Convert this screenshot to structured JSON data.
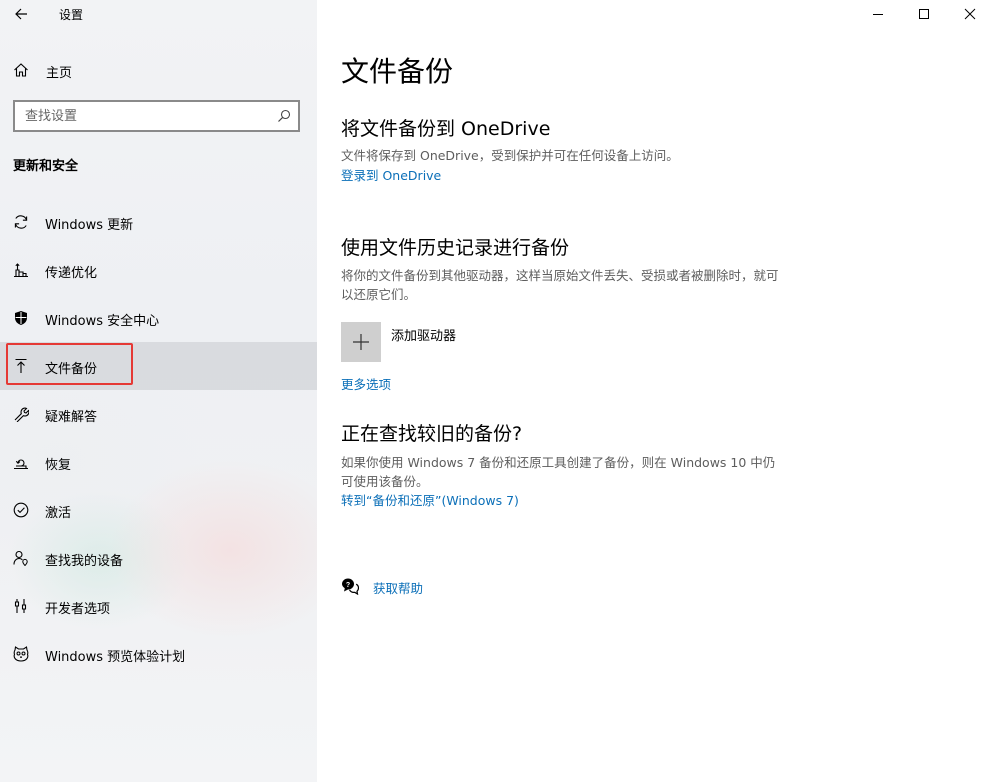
{
  "window": {
    "title": "设置",
    "controls": {
      "minimize": "minimize-icon",
      "maximize": "maximize-icon",
      "close": "close-icon"
    }
  },
  "sidebar": {
    "home_label": "主页",
    "search_placeholder": "查找设置",
    "section_title": "更新和安全",
    "items": [
      {
        "label": "Windows 更新",
        "icon": "refresh-icon"
      },
      {
        "label": "传递优化",
        "icon": "delivery-optimization-icon"
      },
      {
        "label": "Windows 安全中心",
        "icon": "shield-icon"
      },
      {
        "label": "文件备份",
        "icon": "backup-upload-icon",
        "active": true
      },
      {
        "label": "疑难解答",
        "icon": "wrench-icon"
      },
      {
        "label": "恢复",
        "icon": "recovery-icon"
      },
      {
        "label": "激活",
        "icon": "check-circle-icon"
      },
      {
        "label": "查找我的设备",
        "icon": "person-location-icon"
      },
      {
        "label": "开发者选项",
        "icon": "developer-tools-icon"
      },
      {
        "label": "Windows 预览体验计划",
        "icon": "insider-cat-icon"
      }
    ]
  },
  "main": {
    "title": "文件备份",
    "onedrive": {
      "heading": "将文件备份到 OneDrive",
      "desc": "文件将保存到 OneDrive，受到保护并可在任何设备上访问。",
      "link": "登录到 OneDrive"
    },
    "file_history": {
      "heading": "使用文件历史记录进行备份",
      "desc": "将你的文件备份到其他驱动器，这样当原始文件丢失、受损或者被删除时，就可以还原它们。",
      "add_drive": "添加驱动器",
      "more_options": "更多选项"
    },
    "older_backup": {
      "heading": "正在查找较旧的备份?",
      "desc": "如果你使用 Windows 7 备份和还原工具创建了备份，则在 Windows 10 中仍可使用该备份。",
      "link": "转到“备份和还原”(Windows 7)"
    },
    "help_label": "获取帮助"
  },
  "colors": {
    "accent": "#0b6fb8",
    "highlight_border": "#e53935",
    "active_bg": "#d2d4d8"
  }
}
